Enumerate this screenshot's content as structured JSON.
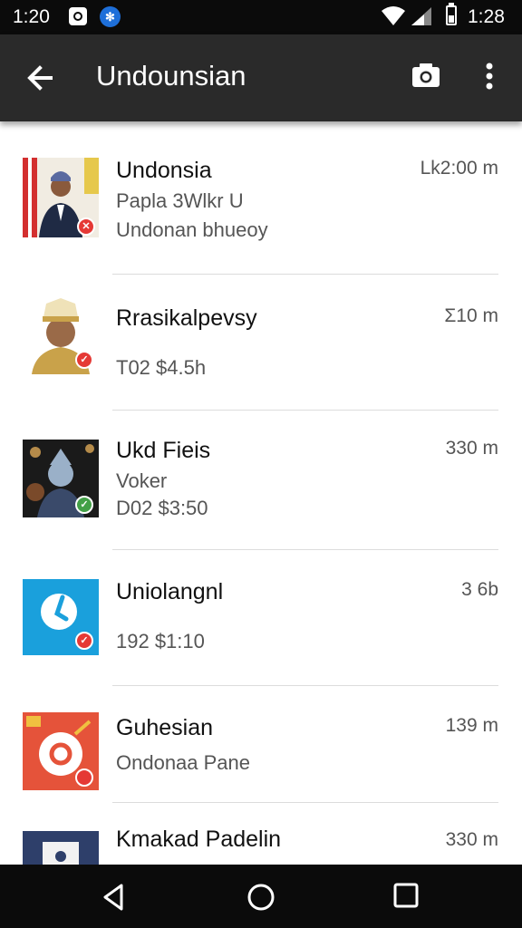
{
  "status_bar": {
    "time_left": "1:20",
    "time_right": "1:28"
  },
  "app_bar": {
    "title": "Undounsian",
    "back_icon": "arrow-left-icon",
    "camera_icon": "camera-icon",
    "more_icon": "more-vert-icon"
  },
  "conversations": [
    {
      "name": "Undonsia",
      "line2": "Papla 3Wlkr U",
      "line3": "Undonan bhueoy",
      "time": "Lk2:00 m",
      "badge_color": "#e53935",
      "badge": "✕"
    },
    {
      "name": "Rrasikalpevsy",
      "line2": "",
      "line3": "T02 $4.5h",
      "time": "Σ10 m",
      "badge_color": "#e53935",
      "badge": "✓"
    },
    {
      "name": "Ukd Fieis",
      "line2": "Voker",
      "line3": "D02 $3:50",
      "time": "330 m",
      "badge_color": "#43a047",
      "badge": "✓"
    },
    {
      "name": "Uniolangnl",
      "line2": "",
      "line3": "192 $1:10",
      "time": "3 6b",
      "badge_color": "#e53935",
      "badge": "✓"
    },
    {
      "name": "Guhesian",
      "line2": "Ondonaa Pane",
      "line3": "",
      "time": "139 m",
      "badge_color": "#e53935",
      "badge": ""
    },
    {
      "name": "Kmakad Padelin",
      "line2": "",
      "line3": "",
      "time": "330 m",
      "badge_color": "",
      "badge": ""
    }
  ],
  "nav_bar": {
    "back_icon": "nav-back-icon",
    "home_icon": "nav-home-icon",
    "recents_icon": "nav-recents-icon"
  }
}
